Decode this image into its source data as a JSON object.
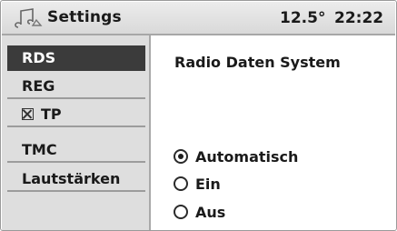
{
  "header": {
    "icon": "music-note-icon",
    "title": "Settings",
    "temperature": "12.5°",
    "time": "22:22"
  },
  "sidebar": {
    "items": [
      {
        "label": "RDS",
        "selected": true
      },
      {
        "label": "REG",
        "selected": false
      },
      {
        "label": "TP",
        "selected": false,
        "checkbox": "checked"
      },
      {
        "label": "TMC",
        "selected": false
      },
      {
        "label": "Lautstärken",
        "selected": false
      }
    ]
  },
  "main": {
    "title": "Radio Daten System",
    "options": [
      {
        "label": "Automatisch",
        "checked": true
      },
      {
        "label": "Ein",
        "checked": false
      },
      {
        "label": "Aus",
        "checked": false
      }
    ]
  },
  "colors": {
    "selected_bg": "#3b3b3b",
    "sidebar_bg": "#dedede",
    "header_bg": "#e3e3e3"
  }
}
